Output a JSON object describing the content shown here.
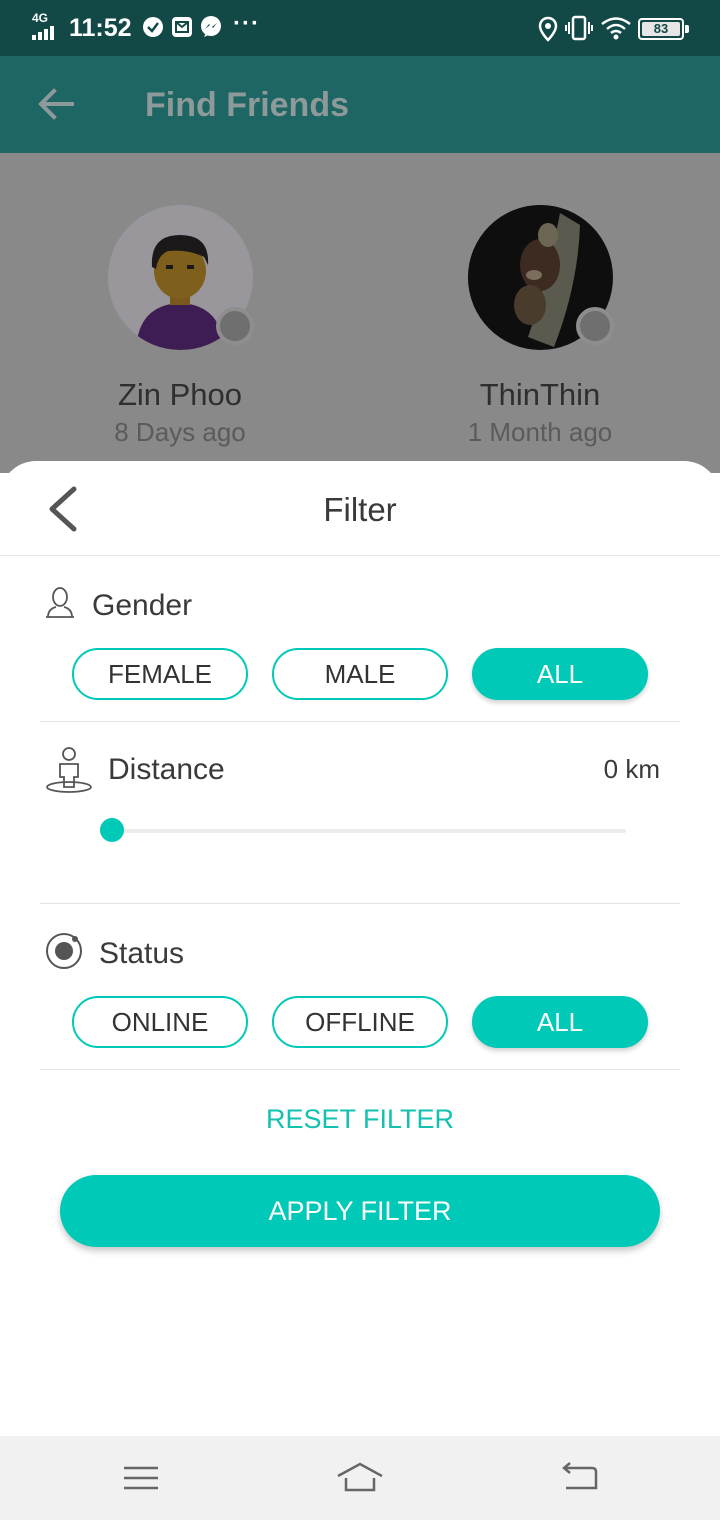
{
  "status_bar": {
    "network": "4G",
    "time": "11:52",
    "more": "···",
    "battery": "83"
  },
  "app_bar": {
    "title": "Find Friends"
  },
  "friends": [
    {
      "name": "Zin Phoo",
      "last_seen": "8 Days ago",
      "presence": "offline"
    },
    {
      "name": "ThinThin",
      "last_seen": "1 Month ago",
      "presence": "offline"
    }
  ],
  "filter": {
    "title": "Filter",
    "gender": {
      "label": "Gender",
      "options": [
        "FEMALE",
        "MALE",
        "ALL"
      ],
      "selected": "ALL"
    },
    "distance": {
      "label": "Distance",
      "value": "0 km",
      "slider_fraction": 0
    },
    "status": {
      "label": "Status",
      "options": [
        "ONLINE",
        "OFFLINE",
        "ALL"
      ],
      "selected": "ALL"
    },
    "reset_label": "RESET FILTER",
    "apply_label": "APPLY FILTER"
  },
  "colors": {
    "accent": "#00c9b7",
    "status_bar": "#124947",
    "app_bar": "#1e6663"
  }
}
